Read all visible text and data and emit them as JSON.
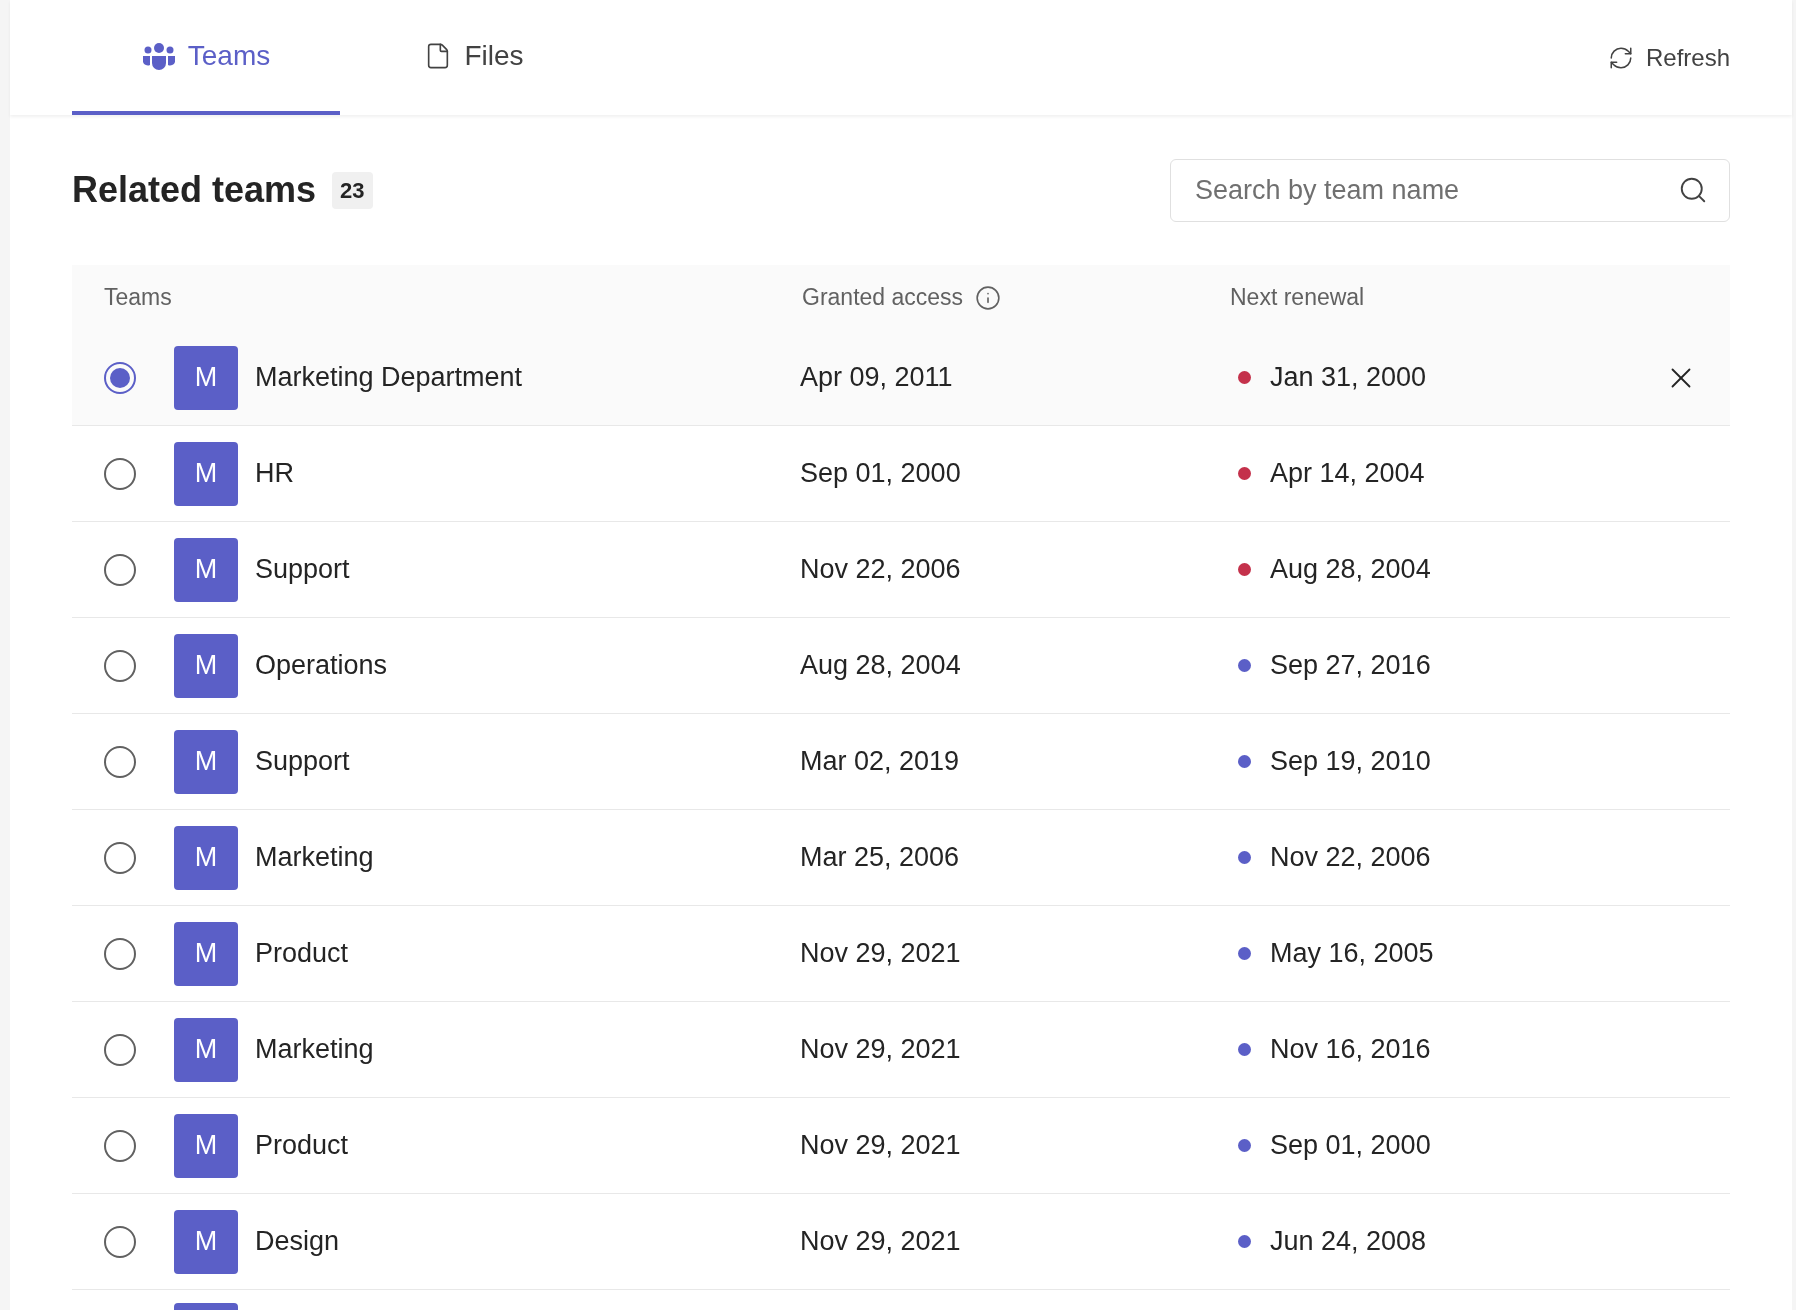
{
  "tabs": [
    {
      "label": "Teams",
      "kind": "teams",
      "selected": true
    },
    {
      "label": "Files",
      "kind": "file",
      "selected": false
    }
  ],
  "refresh": {
    "label": "Refresh"
  },
  "heading": {
    "title": "Related teams",
    "count": "23"
  },
  "search": {
    "placeholder": "Search by team name"
  },
  "table": {
    "columns": [
      "Teams",
      "Granted access",
      "Next renewal"
    ],
    "rows": [
      {
        "avatar": "M",
        "name": "Marketing Department",
        "granted": "Apr 09, 2011",
        "renewal": "Jan 31, 2000",
        "color": "#c4314b",
        "selected": true
      },
      {
        "avatar": "M",
        "name": "HR",
        "granted": "Sep 01, 2000",
        "renewal": "Apr 14, 2004",
        "color": "#c4314b",
        "selected": false
      },
      {
        "avatar": "M",
        "name": "Support",
        "granted": "Nov 22, 2006",
        "renewal": "Aug 28, 2004",
        "color": "#c4314b",
        "selected": false
      },
      {
        "avatar": "M",
        "name": "Operations",
        "granted": "Aug 28, 2004",
        "renewal": "Sep 27, 2016",
        "color": "#5b5fc7",
        "selected": false
      },
      {
        "avatar": "M",
        "name": "Support",
        "granted": "Mar 02, 2019",
        "renewal": "Sep 19, 2010",
        "color": "#5b5fc7",
        "selected": false
      },
      {
        "avatar": "M",
        "name": "Marketing",
        "granted": "Mar 25, 2006",
        "renewal": "Nov 22, 2006",
        "color": "#5b5fc7",
        "selected": false
      },
      {
        "avatar": "M",
        "name": "Product",
        "granted": "Nov 29, 2021",
        "renewal": "May 16, 2005",
        "color": "#5b5fc7",
        "selected": false
      },
      {
        "avatar": "M",
        "name": "Marketing",
        "granted": "Nov 29, 2021",
        "renewal": "Nov 16, 2016",
        "color": "#5b5fc7",
        "selected": false
      },
      {
        "avatar": "M",
        "name": "Product",
        "granted": "Nov 29, 2021",
        "renewal": "Sep 01, 2000",
        "color": "#5b5fc7",
        "selected": false
      },
      {
        "avatar": "M",
        "name": "Design",
        "granted": "Nov 29, 2021",
        "renewal": "Jun 24, 2008",
        "color": "#5b5fc7",
        "selected": false
      }
    ]
  }
}
